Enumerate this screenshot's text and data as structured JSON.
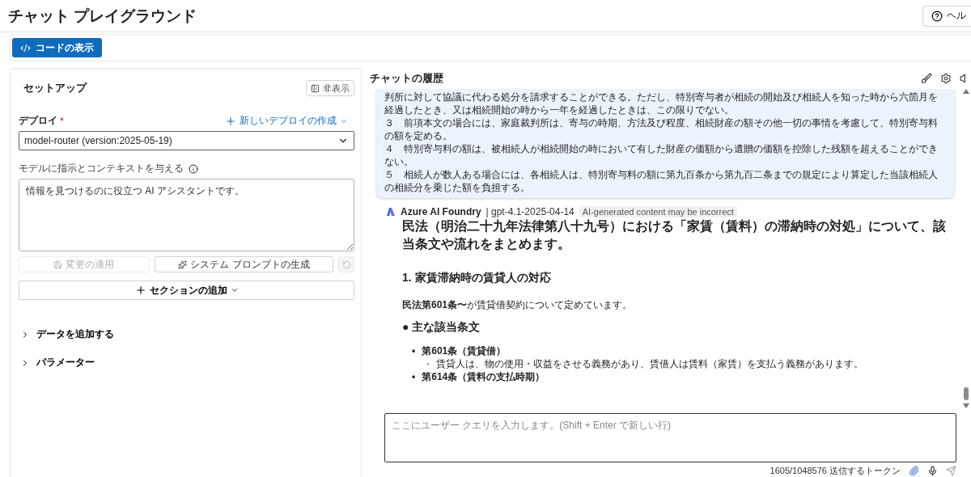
{
  "page": {
    "title": "チャット プレイグラウンド",
    "help_button": "ヘル"
  },
  "toolbar": {
    "view_code_button": "コードの表示"
  },
  "setup": {
    "title": "セットアップ",
    "hide_button": "非表示",
    "deploy": {
      "label": "デプロイ",
      "required_mark": "*",
      "create_link": "新しいデプロイの作成",
      "value": "model-router (version:2025-05-19)"
    },
    "instructions": {
      "label": "モデルに指示とコンテキストを与える",
      "value": "情報を見つけるのに役立つ AI アシスタントです。"
    },
    "actions": [
      {
        "kind": "save",
        "label": "変更の適用",
        "disabled": true
      },
      {
        "kind": "generate",
        "label": "システム プロンプトの生成",
        "disabled": false
      },
      {
        "kind": "reset",
        "disabled": true
      }
    ],
    "add_section_button": "セクションの追加",
    "accordions": [
      {
        "label": "データを追加する",
        "expanded": false
      },
      {
        "label": "パラメーター",
        "expanded": false
      }
    ]
  },
  "chat": {
    "title": "チャットの履歴",
    "user_message": [
      "判所に対して協議に代わる処分を請求することができる。ただし、特別寄与者が相続の開始及び相続人を知った時から六箇月を経過したとき、又は相続開始の時から一年を経過したときは、この限りでない。",
      "３　前項本文の場合には、家庭裁判所は、寄与の時期、方法及び程度、相続財産の額その他一切の事情を考慮して、特別寄与料の額を定める。",
      "４　特別寄与料の額は、被相続人が相続開始の時において有した財産の価額から遺贈の価額を控除した残額を超えることができない。",
      "５　相続人が数人ある場合には、各相続人は、特別寄与料の額に第九百条から第九百二条までの規定により算定した当該相続人の相続分を乗じた額を負担する。"
    ],
    "response": {
      "source": "Azure AI Foundry",
      "model": "| gpt-4.1-2025-04-14",
      "disclaimer": "AI-generated content may be incorrect",
      "blocks": [
        {
          "kind": "lead",
          "text": "民法（明治二十九年法律第八十九号）における「家賃（賃料）の滞納時の対処」について、該当条文や流れをまとめます。"
        },
        {
          "kind": "heading",
          "text": "1. 家賃滞納時の賃貸人の対応"
        },
        {
          "kind": "paragraph",
          "text": "**民法第601条〜**が賃貸借契約について定めています。"
        },
        {
          "kind": "subheading",
          "text": "● 主な該当条文"
        },
        {
          "kind": "list",
          "items": [
            {
              "marker": "•",
              "text": "第601条（賃貸借）",
              "children": [
                {
                  "marker": "◦",
                  "text": "賃貸人は、物の使用・収益をさせる義務があり、賃借人は賃料（家賃）を支払う義務があります。"
                }
              ]
            },
            {
              "marker": "•",
              "text": "第614条（賃料の支払時期）"
            }
          ]
        }
      ]
    },
    "input": {
      "placeholder": "ここにユーザー クエリを入力します。(Shift + Enter で新しい行)"
    },
    "token_count": "1605/1048576 送信するトークン"
  }
}
